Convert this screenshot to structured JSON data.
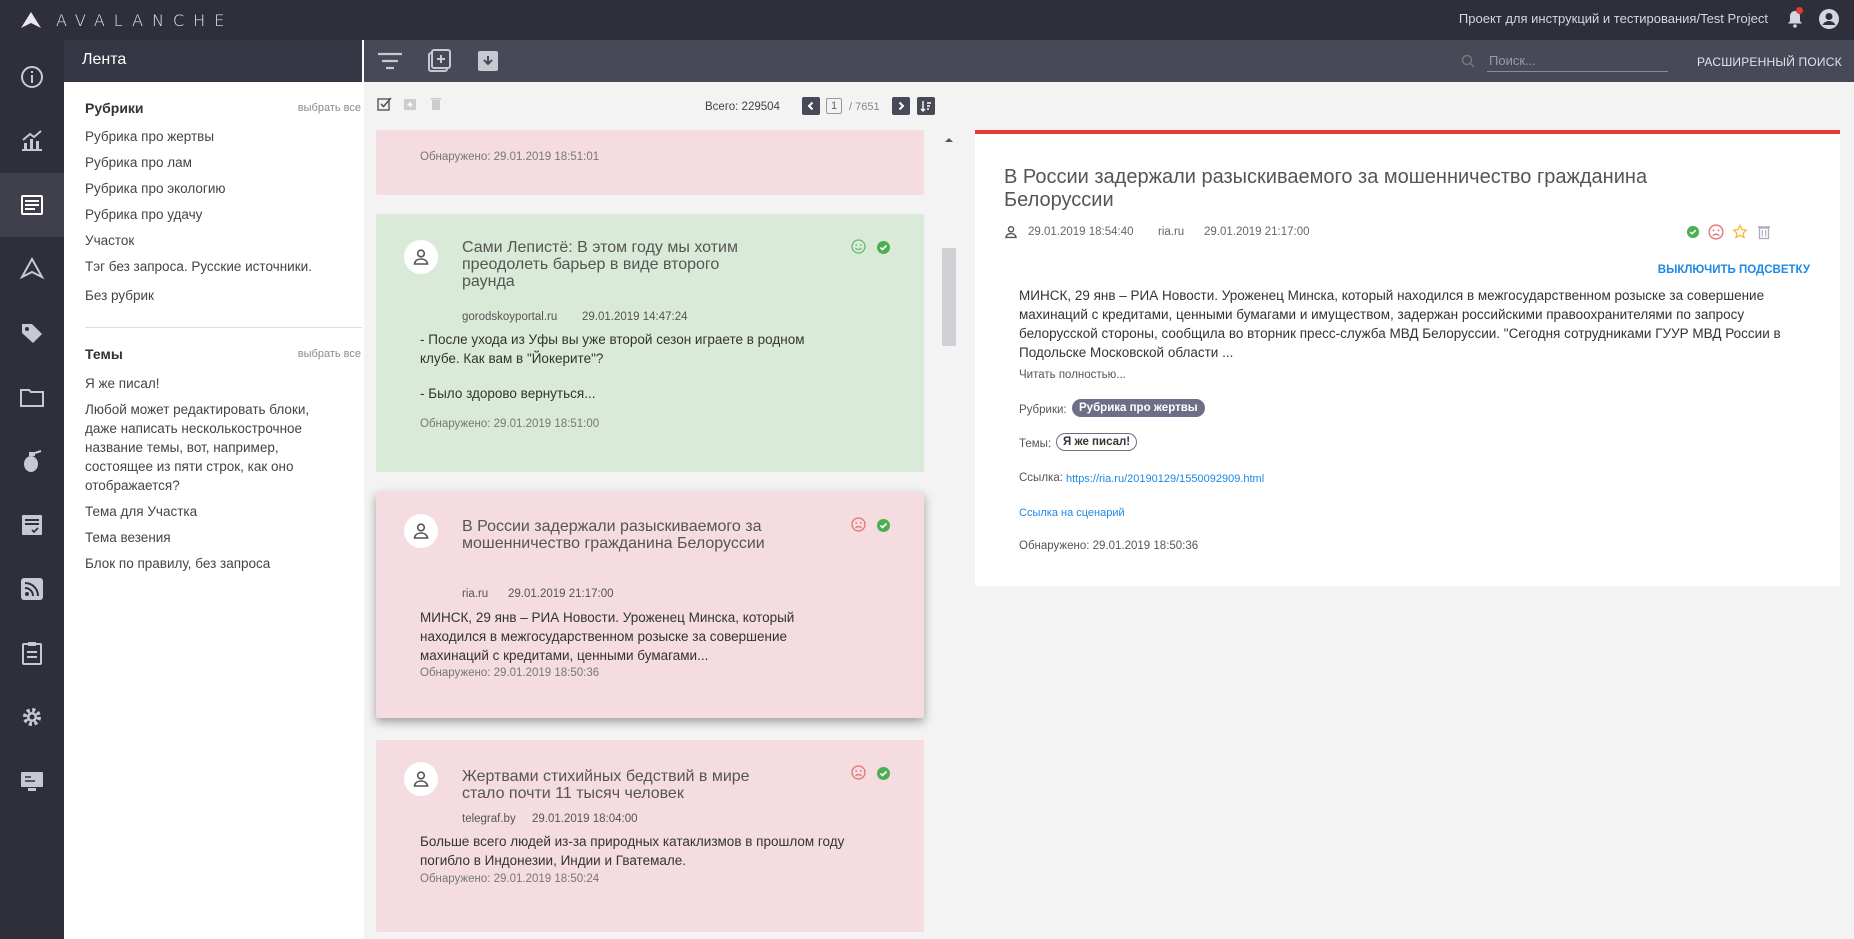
{
  "app": {
    "name": "AVALANCHE",
    "project": "Проект для инструкций и тестирования/Test Project"
  },
  "header": {
    "section_title": "Лента",
    "search_placeholder": "Поиск...",
    "advanced_search": "РАСШИРЕННЫЙ ПОИСК"
  },
  "sidebar": {
    "items": [
      {
        "icon": "info-icon"
      },
      {
        "icon": "analytics-icon"
      },
      {
        "icon": "feed-icon",
        "active": true
      },
      {
        "icon": "avalanche-icon"
      },
      {
        "icon": "tag-icon"
      },
      {
        "icon": "folder-icon"
      },
      {
        "icon": "grenade-icon"
      },
      {
        "icon": "report-icon"
      },
      {
        "icon": "rss-icon"
      },
      {
        "icon": "clipboard-icon"
      },
      {
        "icon": "gear-icon"
      },
      {
        "icon": "monitor-icon"
      }
    ]
  },
  "filters": {
    "rubrics_title": "Рубрики",
    "rubrics_select_all": "выбрать все",
    "rubrics": [
      "Рубрика про жертвы",
      "Рубрика про лам",
      "Рубрика про экологию",
      "Рубрика про удачу",
      "Участок",
      "Тэг без запроса. Русские источники.",
      "Без рубрик"
    ],
    "themes_title": "Темы",
    "themes_select_all": "выбрать все",
    "themes": [
      "Я же писал!",
      "Любой может редактировать блоки, даже написать несколькострочное название темы, вот, например, состоящее из пяти строк, как оно отображается?",
      "Тема для Участка",
      "Тема везения",
      "Блок по правилу, без запроса"
    ]
  },
  "toolbar": {
    "total": "Всего: 229504",
    "page": "1",
    "page_count": "/  7651"
  },
  "feed": [
    {
      "found": "Обнаружено: 29.01.2019 18:51:01"
    },
    {
      "title": "Сами Лепистё: В этом году мы хотим преодолеть барьер в виде второго раунда",
      "source": "gorodskoyportal.ru",
      "date": "29.01.2019 14:47:24",
      "body1": "- После ухода из Уфы вы уже второй сезон играете в родном клубе. Как вам в \"Йокерите\"?",
      "body2": "- Было здорово вернуться...",
      "found": "Обнаружено: 29.01.2019 18:51:00",
      "sentiment": "positive"
    },
    {
      "title": "В России задержали разыскиваемого за мошенничество гражданина Белоруссии",
      "source": "ria.ru",
      "date": "29.01.2019 21:17:00",
      "body": "МИНСК, 29 янв – РИА Новости. Уроженец Минска, который находился в межгосударственном розыске за совершение махинаций с кредитами, ценными бумагами...",
      "found": "Обнаружено: 29.01.2019 18:50:36",
      "sentiment": "negative"
    },
    {
      "title": "Жертвами стихийных бедствий в мире стало почти 11 тысяч человек",
      "source": "telegraf.by",
      "date": "29.01.2019 18:04:00",
      "body": "Больше всего людей из-за природных катаклизмов в прошлом году погибло в Индонезии, Индии и Гватемале.",
      "found": "Обнаружено: 29.01.2019 18:50:24",
      "sentiment": "negative"
    }
  ],
  "detail": {
    "title": "В России задержали разыскиваемого за мошенничество гражданина Белоруссии",
    "published": "29.01.2019 18:54:40",
    "source": "ria.ru",
    "date": "29.01.2019 21:17:00",
    "unhighlight": "ВЫКЛЮЧИТЬ ПОДСВЕТКУ",
    "body": "МИНСК, 29 янв – РИА Новости. Уроженец Минска, который находился в межгосударственном розыске за совершение махинаций с кредитами, ценными бумагами и имуществом, задержан российскими правоохранителями по запросу белорусской стороны, сообщила во вторник пресс-служба МВД Белоруссии. \"Сегодня сотрудниками ГУУР МВД России в Подольске Московской области ...",
    "read_more": "Читать полностью...",
    "rubrics_label": "Рубрики:",
    "rubric": "Рубрика про жертвы",
    "themes_label": "Темы:",
    "theme": "Я же писал!",
    "link_label": "Ссылка:",
    "link": "https://ria.ru/20190129/1550092909.html",
    "scenario_link": "Ссылка на сценарий",
    "found": "Обнаружено: 29.01.2019 18:50:36"
  },
  "colors": {
    "accent": "#e53935",
    "dark": "#2e2f3a",
    "link": "#1e88e5",
    "positive": "#4caf50",
    "negative": "#e57373"
  }
}
